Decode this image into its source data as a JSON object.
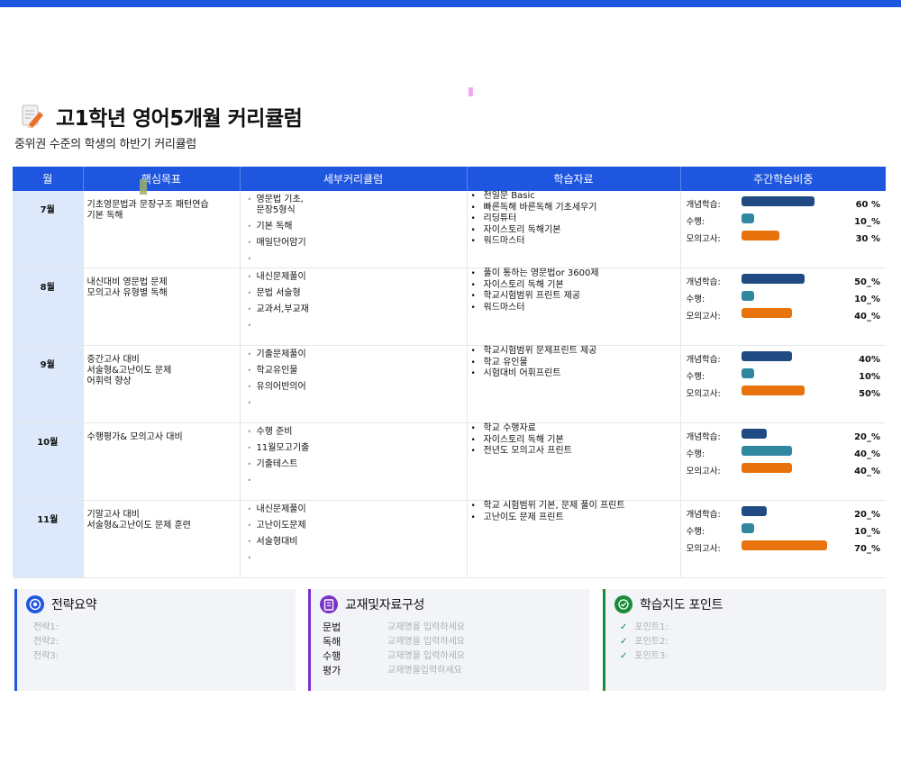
{
  "header": {
    "title": "고1학년 영어5개월 커리큘럼",
    "subtitle": "중위권 수준의 학생의 하반기 커리큘럼"
  },
  "table": {
    "columns": [
      "월",
      "핵심목표",
      "세부커리큘럼",
      "학습자료",
      "주간학습비중"
    ],
    "weight_labels": [
      "개념학습:",
      "수행:",
      "모의고사:"
    ],
    "rows": [
      {
        "month": "7월",
        "goal": "기초영문법과 문장구조 패턴연습\n기본 독해",
        "details": [
          "영문법 기초,\n문장5형식",
          "기본 독해",
          "매일단어암기"
        ],
        "materials": [
          "천일문 Basic",
          "빠른독해 바른독해 기초세우기",
          "리딩튜터",
          "자이스토리 독해기본",
          "워드마스터"
        ],
        "weights": [
          {
            "value": 60,
            "label": "60 %"
          },
          {
            "value": 10,
            "label": "10_%"
          },
          {
            "value": 30,
            "label": "30 %"
          }
        ]
      },
      {
        "month": "8월",
        "goal": "내신대비 영문법 문제\n모의고사 유형별 독해",
        "details": [
          "내신문제풀이",
          "문법 서술형",
          "교과서,부교재"
        ],
        "materials": [
          "풀이 통하는 영문법or 3600제",
          "자이스토리 독해 기본",
          "학교시험범위 프린트 제공",
          "워드마스터"
        ],
        "weights": [
          {
            "value": 50,
            "label": "50_%"
          },
          {
            "value": 10,
            "label": "10_%"
          },
          {
            "value": 40,
            "label": "40_%"
          }
        ]
      },
      {
        "month": "9월",
        "goal": "중간고사 대비\n서술형&고난이도 문제\n어휘력 향상",
        "details": [
          "기출문제풀이",
          "학교유인물",
          "유의어반의어"
        ],
        "materials": [
          "학교시험범위 문제프린트 제공",
          "학교 유인물",
          "시험대비 어휘프린트"
        ],
        "weights": [
          {
            "value": 40,
            "label": "40%"
          },
          {
            "value": 10,
            "label": "10%"
          },
          {
            "value": 50,
            "label": "50%"
          }
        ]
      },
      {
        "month": "10월",
        "goal": "수행평가& 모의고사 대비",
        "details": [
          "수행 준비",
          "11월모고기출",
          "기출테스트"
        ],
        "materials": [
          "학교 수행자료",
          "자이스토리 독해 기본",
          "전년도 모의고사 프린트"
        ],
        "weights": [
          {
            "value": 20,
            "label": "20_%"
          },
          {
            "value": 40,
            "label": "40_%"
          },
          {
            "value": 40,
            "label": "40_%"
          }
        ]
      },
      {
        "month": "11월",
        "goal": "기말고사 대비\n서술형&고난이도 문제 훈련",
        "details": [
          "내신문제풀이",
          "고난이도문제",
          "서술형대비"
        ],
        "materials": [
          "학교 시험범위 기본, 문제 풀이 프린트",
          "고난이도 문제 프린트"
        ],
        "weights": [
          {
            "value": 20,
            "label": "20_%"
          },
          {
            "value": 10,
            "label": "10_%"
          },
          {
            "value": 70,
            "label": "70_%"
          }
        ]
      }
    ]
  },
  "cards": {
    "strategy": {
      "title": "전략요약",
      "items": [
        "전략1:",
        "전략2:",
        "전략3:"
      ]
    },
    "materials": {
      "title": "교재및자료구성",
      "rows": [
        {
          "key": "문법",
          "value": "교재명을 입력하세요"
        },
        {
          "key": "독해",
          "value": "교재명을 입력하세요"
        },
        {
          "key": "수행",
          "value": "교재명을 입력하세요"
        },
        {
          "key": "평가",
          "value": "교재명을입력하세요"
        }
      ]
    },
    "points": {
      "title": "학습지도 포인트",
      "items": [
        "포인트1:",
        "포인트2:",
        "포인트3:"
      ]
    }
  },
  "colors": {
    "accent": "#1e56e0",
    "concept_bar": "#1f4a82",
    "performance_bar": "#2f87a0",
    "mock_bar": "#e8720c",
    "month_cell": "#dde9fb"
  },
  "icons": {
    "title": "document-pencil-icon",
    "strategy": "target-icon",
    "materials": "book-icon",
    "points": "check-circle-icon"
  }
}
